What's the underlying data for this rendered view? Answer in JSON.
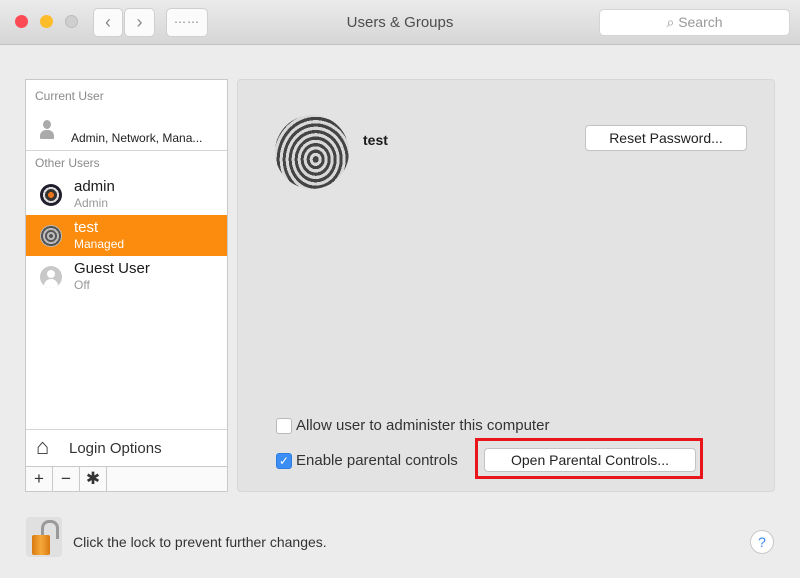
{
  "window": {
    "title": "Users & Groups",
    "nav": {
      "back": "‹",
      "forward": "›",
      "grid": "⋯⋯"
    },
    "search_placeholder": "Search",
    "search_icon": "magnifier-icon"
  },
  "sidebar": {
    "current_user_label": "Current User",
    "current_user": {
      "name": "",
      "subtitle": "Admin, Network, Mana..."
    },
    "other_users_label": "Other Users",
    "users": [
      {
        "name": "admin",
        "subtitle": "Admin",
        "selected": false
      },
      {
        "name": "test",
        "subtitle": "Managed",
        "selected": true
      },
      {
        "name": "Guest User",
        "subtitle": "Off",
        "selected": false
      }
    ],
    "login_options_label": "Login Options",
    "toolbar": {
      "add": "+",
      "remove": "−",
      "settings": "✱"
    }
  },
  "detail": {
    "user_name": "test",
    "reset_password_label": "Reset Password...",
    "allow_admin_label": "Allow user to administer this computer",
    "allow_admin_checked": false,
    "parental_controls_label": "Enable parental controls",
    "parental_controls_checked": true,
    "open_parental_controls_label": "Open Parental Controls..."
  },
  "footer": {
    "lock_text": "Click the lock to prevent further changes.",
    "help_label": "?"
  },
  "colors": {
    "selection": "#fb8c0d",
    "highlight_box": "#e8151b",
    "checkbox": "#3c8ef5"
  }
}
